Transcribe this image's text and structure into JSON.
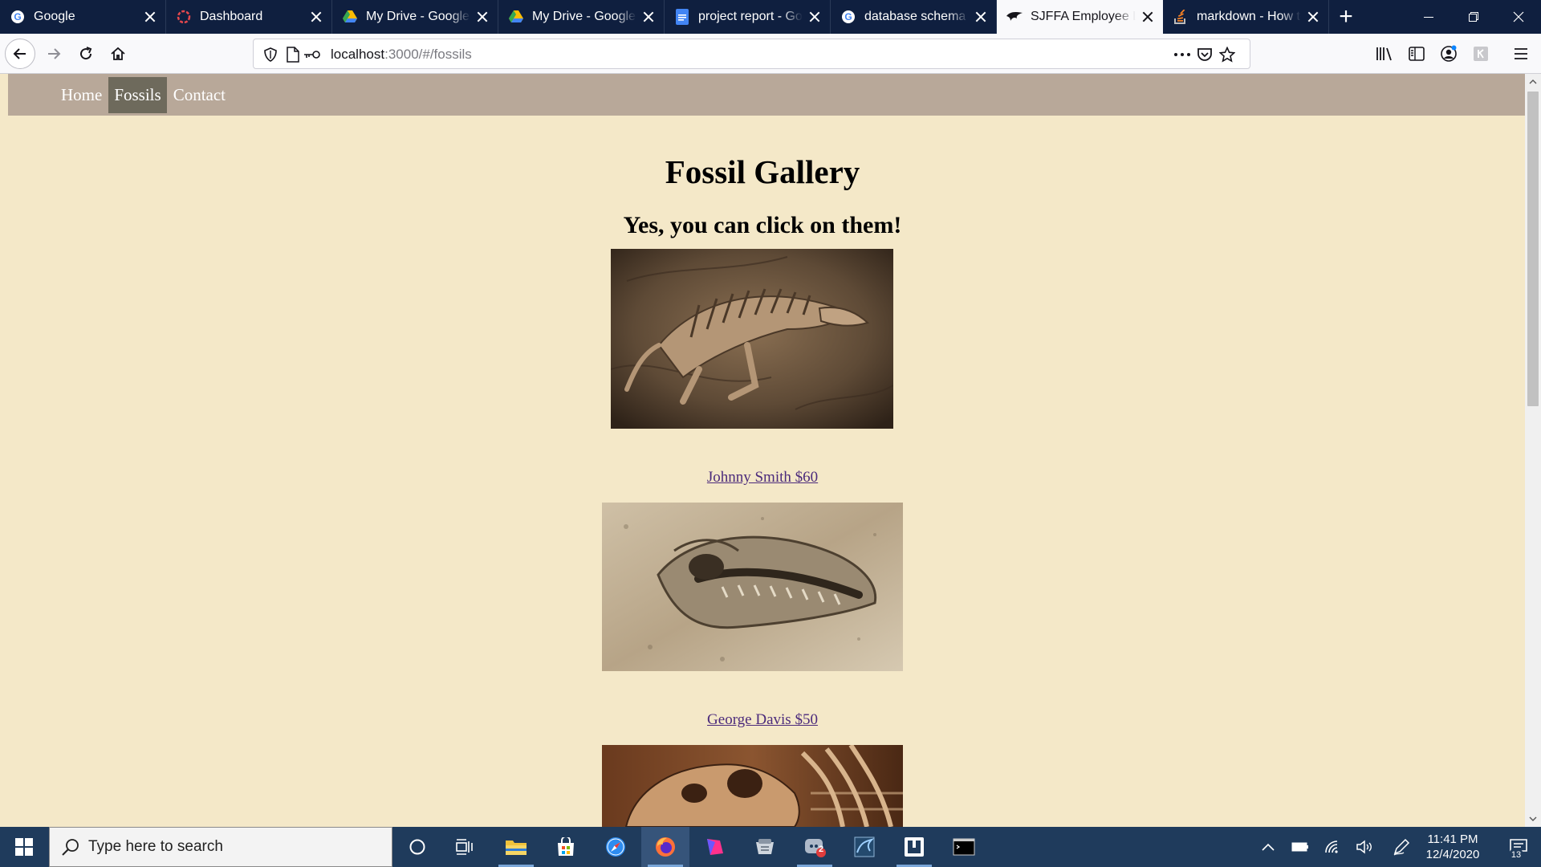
{
  "browser": {
    "tabs": [
      {
        "label": "Google",
        "icon": "google-icon",
        "active": false
      },
      {
        "label": "Dashboard",
        "icon": "dashboard-icon",
        "active": false
      },
      {
        "label": "My Drive - Google Drive",
        "icon": "google-drive-icon",
        "active": false
      },
      {
        "label": "My Drive - Google Drive",
        "icon": "google-drive-icon",
        "active": false
      },
      {
        "label": "project report - Google Docs",
        "icon": "google-docs-icon",
        "active": false
      },
      {
        "label": "database schema diagram",
        "icon": "google-icon",
        "active": false
      },
      {
        "label": "SJFFA Employee Login",
        "icon": "bird-icon",
        "active": true
      },
      {
        "label": "markdown - How to",
        "icon": "stackoverflow-icon",
        "active": false
      }
    ],
    "url": {
      "host": "localhost",
      "rest": ":3000/#/fossils"
    }
  },
  "site": {
    "nav": [
      {
        "label": "Home",
        "active": false
      },
      {
        "label": "Fossils",
        "active": true
      },
      {
        "label": "Contact",
        "active": false
      }
    ],
    "title": "Fossil Gallery",
    "subtitle": "Yes, you can click on them!",
    "fossils": [
      {
        "caption": "Johnny Smith $60"
      },
      {
        "caption": "George Davis $50"
      }
    ]
  },
  "taskbar": {
    "search_placeholder": "Type here to search",
    "time": "11:41 PM",
    "date": "12/4/2020",
    "notification_count": "13",
    "badge_count": "2"
  },
  "colors": {
    "page_bg": "#f4e8c8",
    "site_nav_bg": "#b8a899",
    "active_link_bg": "#6e6a5c",
    "link_color": "#4b2a7b",
    "tabstrip_bg": "#0f1f3f",
    "taskbar_bg": "#1f3b5c"
  }
}
